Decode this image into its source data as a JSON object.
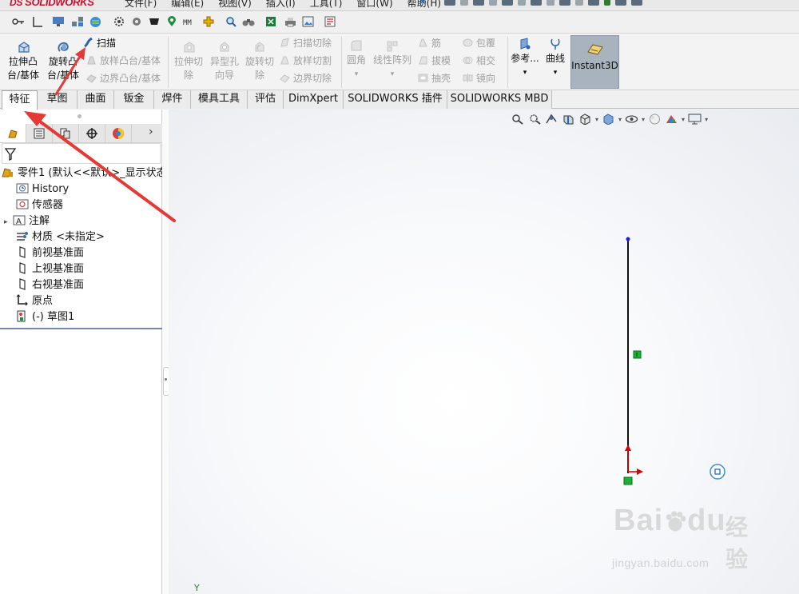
{
  "app": {
    "logo_ds": "DS",
    "logo_text": "SOLIDWORKS"
  },
  "menu": [
    "文件(F)",
    "编辑(E)",
    "视图(V)",
    "插入(I)",
    "工具(T)",
    "窗口(W)",
    "帮助(H)"
  ],
  "commands": {
    "extrude_boss": "拉伸凸\n台/基体",
    "revolve_boss": "旋转凸\n台/基体",
    "sweep": "扫描",
    "loft_boss": "放样凸台/基体",
    "boundary_boss": "边界凸台/基体",
    "extrude_cut": "拉伸切\n除",
    "hole_wizard": "异型孔\n向导",
    "revolve_cut": "旋转切\n除",
    "swept_cut": "扫描切除",
    "lofted_cut": "放样切割",
    "boundary_cut": "边界切除",
    "fillet": "圆角",
    "linear_pattern": "线性阵列",
    "rib": "筋",
    "draft": "拔模",
    "shell": "抽壳",
    "wrap": "包覆",
    "intersect": "相交",
    "mirror": "镜向",
    "reference": "参考...",
    "curves": "曲线",
    "instant3d": "Instant3D"
  },
  "tabs": [
    "特征",
    "草图",
    "曲面",
    "钣金",
    "焊件",
    "模具工具",
    "评估",
    "DimXpert",
    "SOLIDWORKS 插件",
    "SOLIDWORKS MBD"
  ],
  "active_tab": "特征",
  "tree": {
    "root": "零件1  (默认<<默认>_显示状态",
    "items": [
      "History",
      "传感器",
      "注解",
      "材质 <未指定>",
      "前视基准面",
      "上视基准面",
      "右视基准面",
      "原点",
      "(-) 草图1"
    ]
  },
  "watermark": {
    "brand": "Bai",
    "brand2": "du",
    "suffix": "经验",
    "url": "jingyan.baidu.com"
  },
  "axis_label": "Y",
  "colors": {
    "logo": "#c8102e",
    "annotation_arrow": "#e53935",
    "sketch_line": "#111111",
    "point": "#1a1aff",
    "relation": "#19b234",
    "origin": "#e00000",
    "instant3d_bg": "#a9b3bd"
  }
}
